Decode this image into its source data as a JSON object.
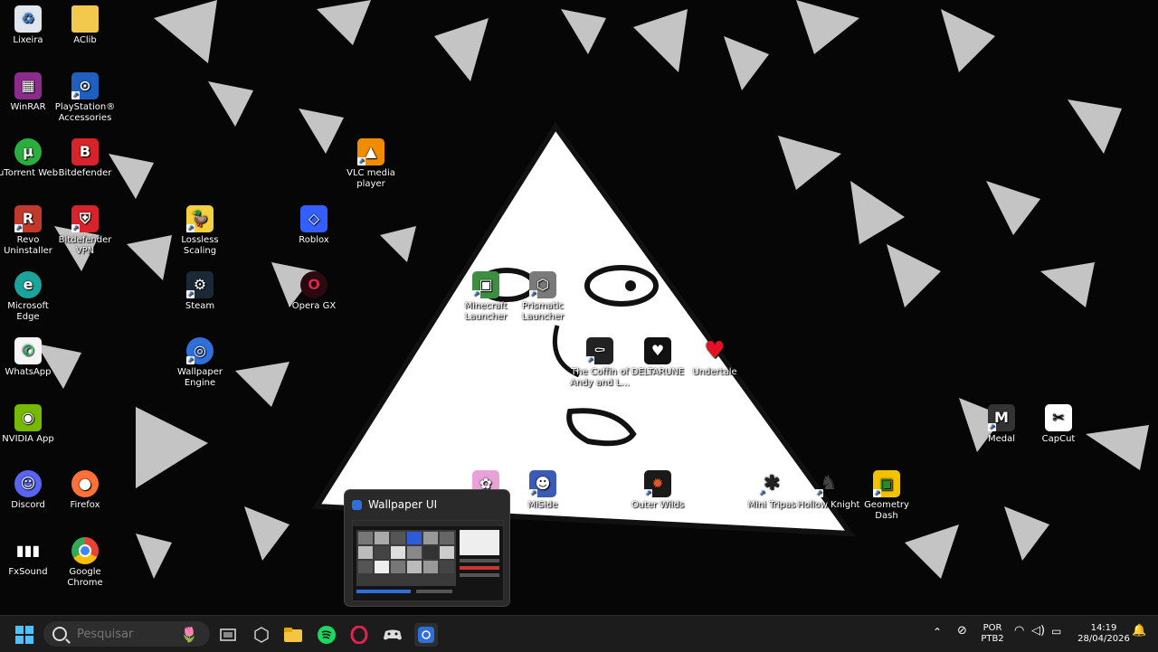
{
  "desktop_icons": [
    {
      "label": "Lixeira",
      "icon": "recycle-bin-icon"
    },
    {
      "label": "AClib",
      "icon": "folder-icon"
    },
    {
      "label": "WinRAR",
      "icon": "winrar-icon"
    },
    {
      "label": "PlayStation® Accessories",
      "icon": "playstation-icon"
    },
    {
      "label": "uTorrent Web",
      "icon": "utorrent-icon"
    },
    {
      "label": "Bitdefender",
      "icon": "bitdefender-icon"
    },
    {
      "label": "Revo Uninstaller",
      "icon": "revo-uninstaller-icon"
    },
    {
      "label": "Bitdefender VPN",
      "icon": "bitdefender-vpn-icon"
    },
    {
      "label": "Lossless Scaling",
      "icon": "lossless-scaling-icon"
    },
    {
      "label": "Roblox",
      "icon": "roblox-icon"
    },
    {
      "label": "VLC media player",
      "icon": "vlc-icon"
    },
    {
      "label": "Microsoft Edge",
      "icon": "edge-icon"
    },
    {
      "label": "Steam",
      "icon": "steam-icon"
    },
    {
      "label": "Opera GX",
      "icon": "opera-gx-icon"
    },
    {
      "label": "Minecraft Launcher",
      "icon": "minecraft-icon"
    },
    {
      "label": "Prismatic Launcher",
      "icon": "prism-launcher-icon"
    },
    {
      "label": "WhatsApp",
      "icon": "whatsapp-icon"
    },
    {
      "label": "Wallpaper Engine",
      "icon": "wallpaper-engine-icon"
    },
    {
      "label": "The Coffin of Andy and L...",
      "icon": "coffin-game-icon"
    },
    {
      "label": "DELTARUNE",
      "icon": "deltarune-icon"
    },
    {
      "label": "Undertale",
      "icon": "undertale-icon"
    },
    {
      "label": "NVIDIA App",
      "icon": "nvidia-icon"
    },
    {
      "label": "Medal",
      "icon": "medal-icon"
    },
    {
      "label": "CapCut",
      "icon": "capcut-icon"
    },
    {
      "label": "Discord",
      "icon": "discord-icon"
    },
    {
      "label": "Firefox",
      "icon": "firefox-icon"
    },
    {
      "label": "",
      "icon": "anime-game-icon"
    },
    {
      "label": "MiSide",
      "icon": "miside-icon"
    },
    {
      "label": "Outer Wilds",
      "icon": "outer-wilds-icon"
    },
    {
      "label": "Mini Tripas",
      "icon": "spider-game-icon"
    },
    {
      "label": "Hollow Knight",
      "icon": "hollow-knight-icon"
    },
    {
      "label": "Geometry Dash",
      "icon": "geometry-dash-icon"
    },
    {
      "label": "FxSound",
      "icon": "fxsound-icon"
    },
    {
      "label": "Google Chrome",
      "icon": "chrome-icon"
    }
  ],
  "taskbar": {
    "search_placeholder": "Pesquisar",
    "pinned": [
      "start-icon",
      "search-icon",
      "flowers-widget-icon",
      "task-view-icon",
      "apps-icon",
      "file-explorer-icon",
      "spotify-icon",
      "opera-gx-icon",
      "gamepad-icon",
      "wallpaper-engine-icon"
    ],
    "preview_title": "Wallpaper UI",
    "language_line1": "POR",
    "language_line2": "PTB2",
    "time": "14:19",
    "date": "28/04/2026"
  }
}
